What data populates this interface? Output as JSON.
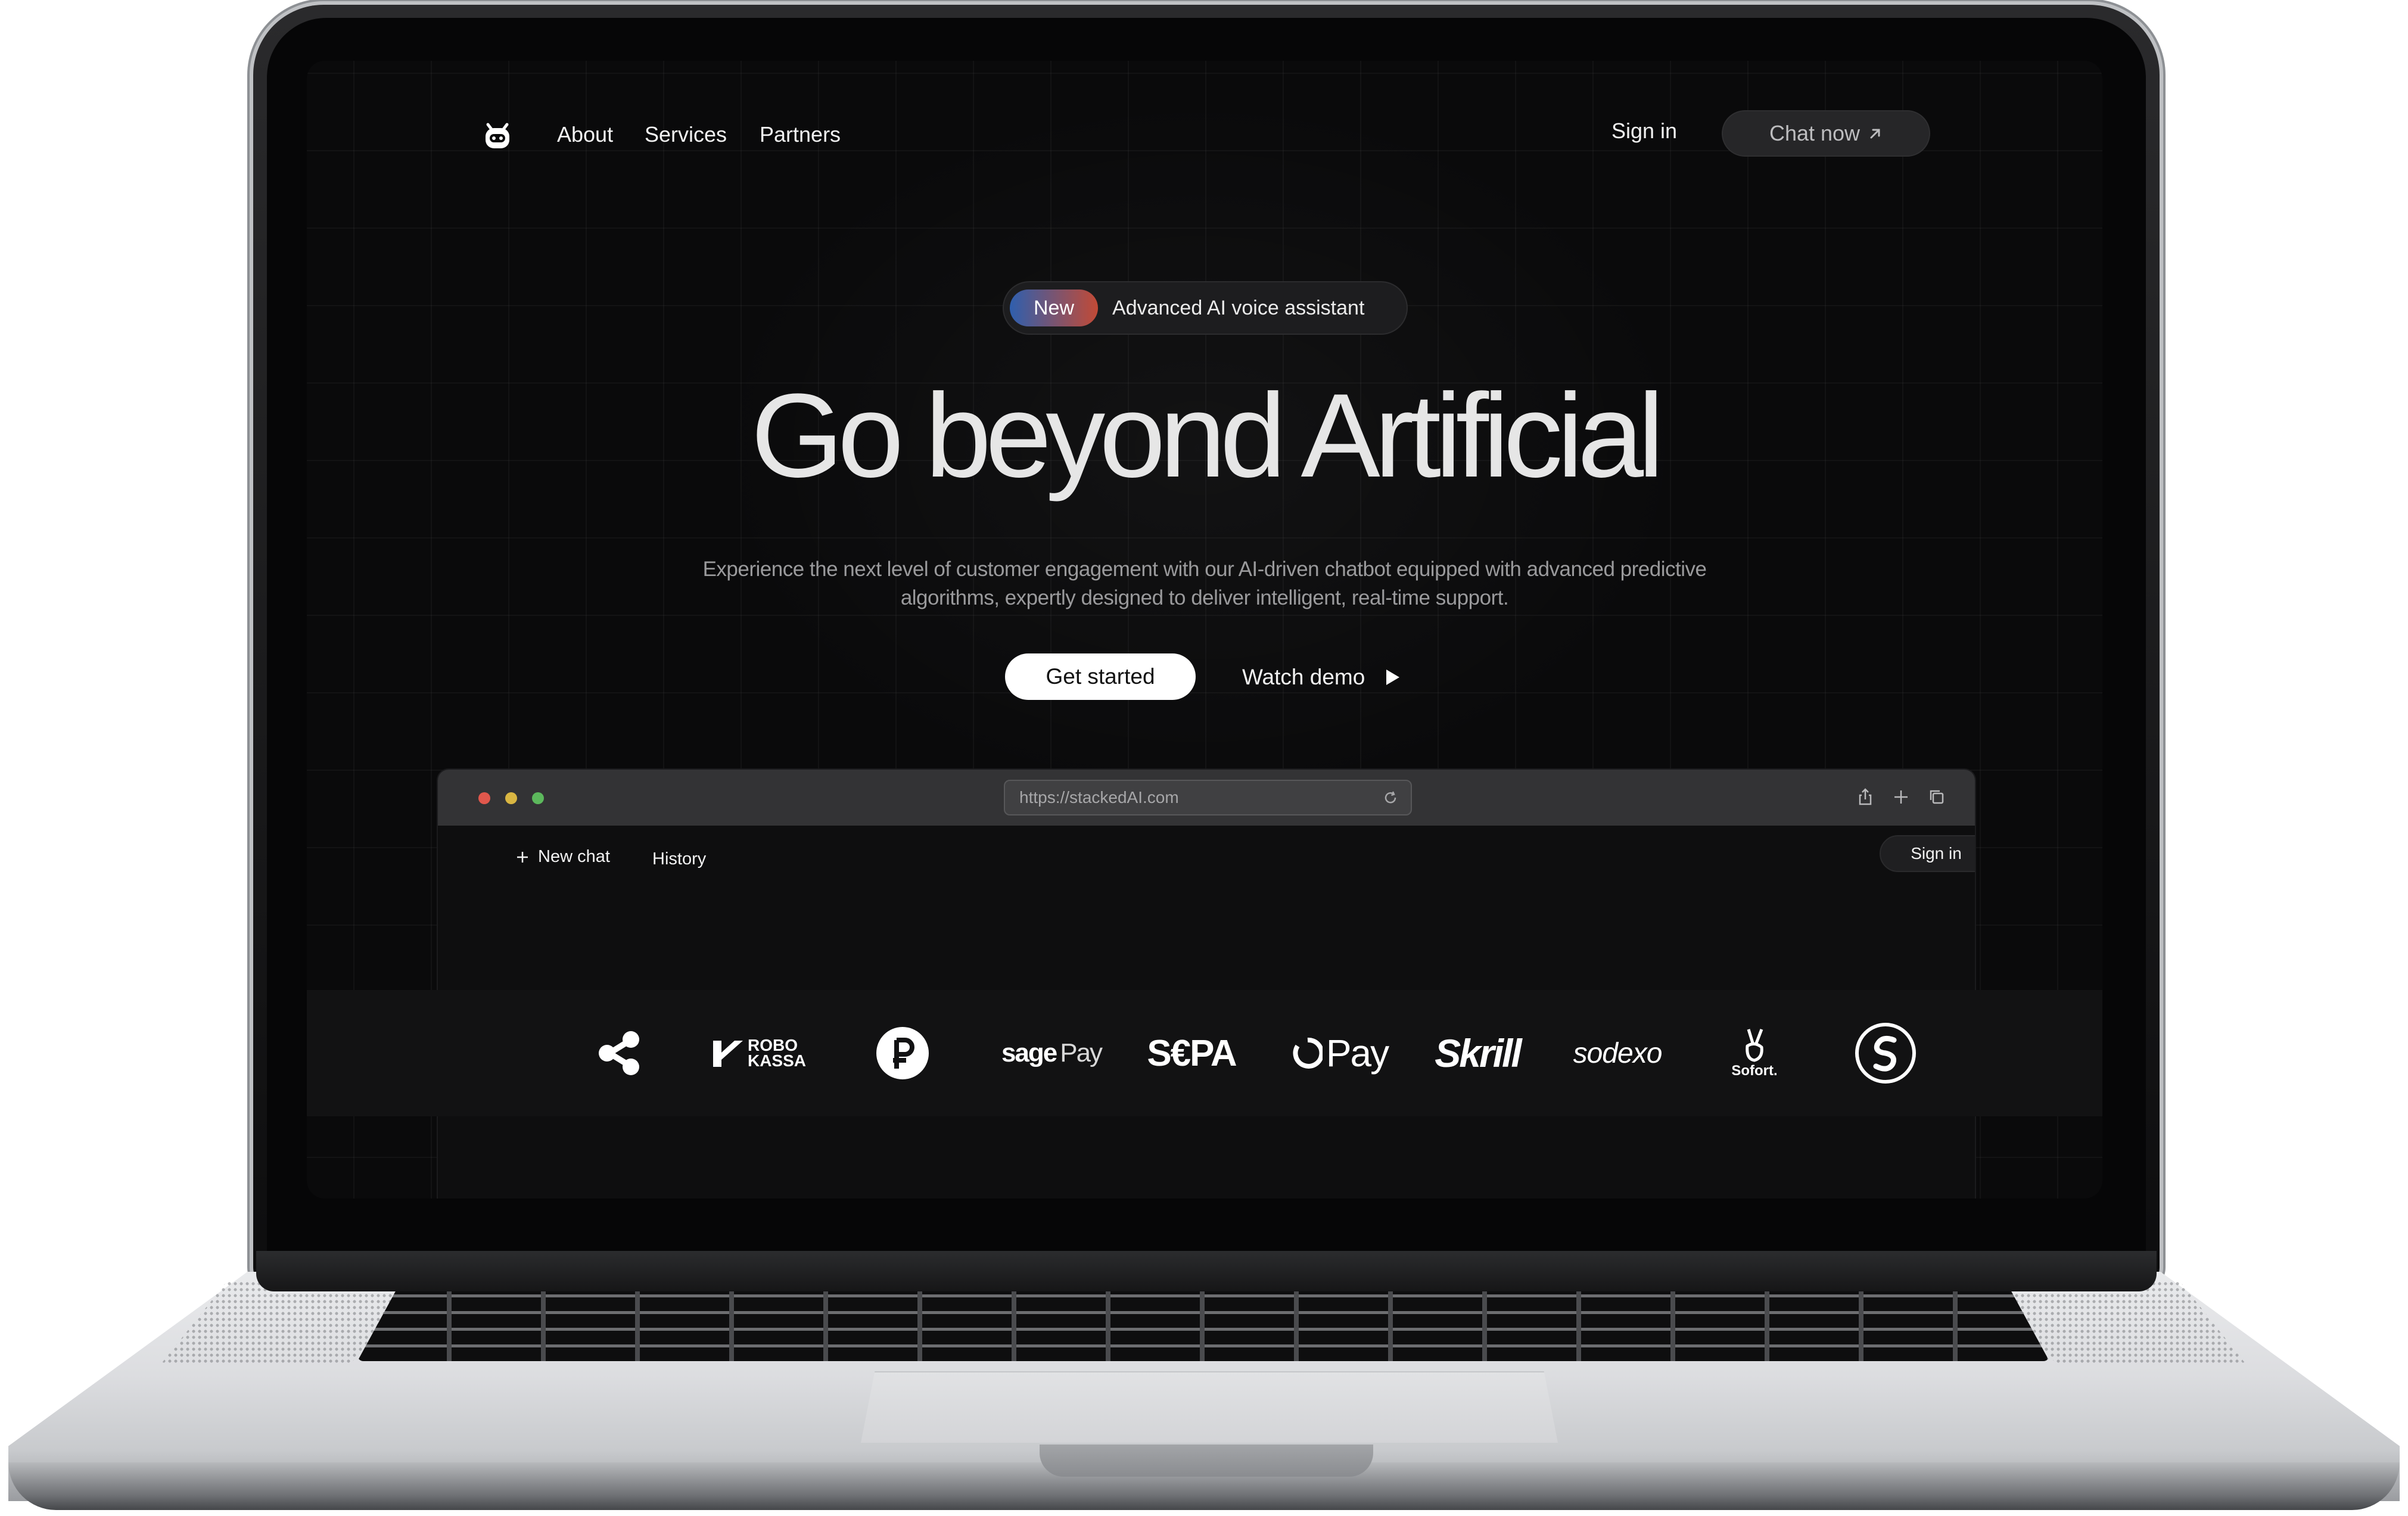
{
  "nav": {
    "links": [
      "About",
      "Services",
      "Partners"
    ],
    "sign_in": "Sign in",
    "chat_now": "Chat now",
    "chat_icon": "arrow-up-right-icon",
    "logo_icon": "robot-logo-icon"
  },
  "hero": {
    "badge_new": "New",
    "badge_text": "Advanced AI voice assistant",
    "title": "Go beyond Artificial",
    "subtitle_line1": "Experience the next level of customer engagement with our AI-driven chatbot equipped with advanced predictive",
    "subtitle_line2": "algorithms, expertly designed to deliver intelligent, real-time support.",
    "get_started": "Get started",
    "watch_demo": "Watch demo",
    "watch_demo_icon": "play-icon"
  },
  "browser": {
    "url": "https://stackedAI.com",
    "new_chat": "New chat",
    "history": "History",
    "sign_in": "Sign in",
    "traffic_lights": [
      "#e0574c",
      "#d9b642",
      "#5cb85c"
    ],
    "toolbar_icons": [
      "share-icon",
      "plus-icon",
      "copy-tabs-icon"
    ]
  },
  "partners": {
    "robokassa_line1": "ROBO",
    "robokassa_line2": "KASSA",
    "sagepay_a": "sage",
    "sagepay_b": "Pay",
    "sepa": "S€PA",
    "opay": "Pay",
    "skrill": "Skrill",
    "sodexo": "sodexo",
    "sofort": "Sofort.",
    "icons": [
      "ripple-logo-icon",
      "robokassa-logo-icon",
      "ruble-logo-icon",
      "sagepay-logo",
      "sepa-logo",
      "opay-logo",
      "skrill-logo",
      "sodexo-logo",
      "sofort-logo-icon",
      "swap-logo-icon"
    ]
  },
  "colors": {
    "background": "#0a0a0b",
    "badge_gradient_start": "#2f5fae",
    "badge_gradient_end": "#c24a36",
    "text": "#e6e6e6"
  }
}
